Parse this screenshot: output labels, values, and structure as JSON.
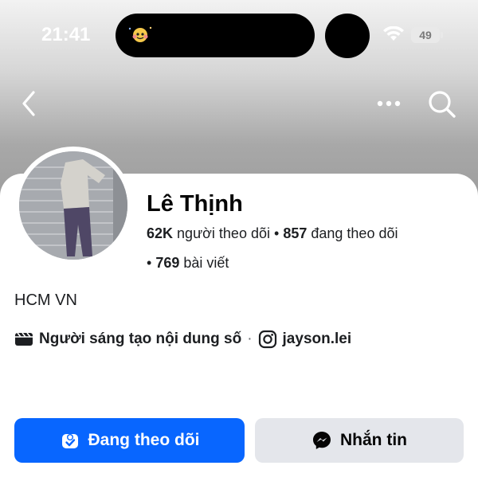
{
  "status_bar": {
    "time": "21:41",
    "battery": "49"
  },
  "header": {
    "back_icon": "chevron-left-icon",
    "more_icon": "more-horizontal-icon",
    "search_icon": "search-icon"
  },
  "profile": {
    "name": "Lê Thịnh",
    "followers_count": "62K",
    "followers_label": "người theo dõi",
    "following_count": "857",
    "following_label": "đang theo dõi",
    "posts_count": "769",
    "posts_label": "bài viết",
    "bio": "HCM VN",
    "category": "Người sáng tạo nội dung số",
    "instagram_handle": "jayson.lei"
  },
  "actions": {
    "follow_label": "Đang theo dõi",
    "message_label": "Nhắn tin"
  },
  "colors": {
    "accent": "#0866ff",
    "secondary_button": "#e4e6eb"
  }
}
